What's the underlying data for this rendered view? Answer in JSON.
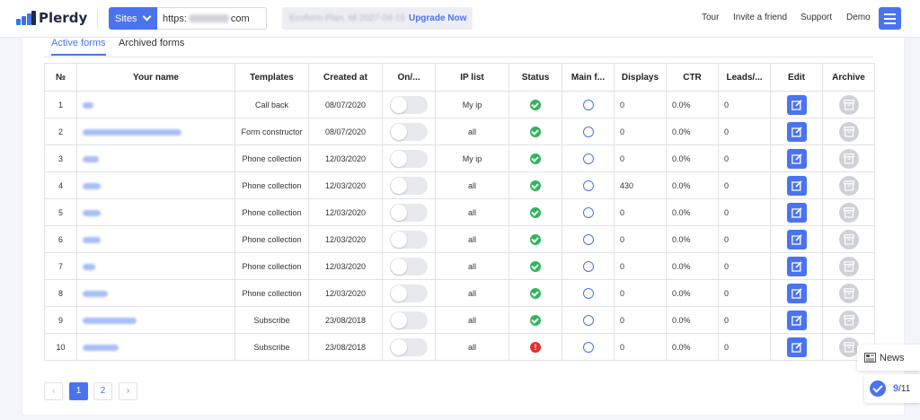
{
  "header": {
    "logo_text": "Plerdy",
    "sites_label": "Sites",
    "url_prefix": "https:",
    "url_suffix": "com",
    "plan_text": "Ecoform Plan, till 2027-04-15",
    "upgrade_label": "Upgrade Now",
    "links": [
      "Tour",
      "Invite a friend",
      "Support",
      "Demo"
    ]
  },
  "tabs": [
    "Active forms",
    "Archived forms"
  ],
  "table": {
    "columns": [
      "№",
      "Your name",
      "Templates",
      "Created at",
      "On/...",
      "IP list",
      "Status",
      "Main f...",
      "Displays",
      "CTR",
      "Leads/...",
      "Edit",
      "Archive"
    ],
    "rows": [
      {
        "num": "1",
        "template": "Call back",
        "created": "08/07/2020",
        "ip": "My ip",
        "status": "ok",
        "displays": "0",
        "ctr": "0.0%",
        "leads": "0"
      },
      {
        "num": "2",
        "template": "Form constructor",
        "created": "08/07/2020",
        "ip": "all",
        "status": "ok",
        "displays": "0",
        "ctr": "0.0%",
        "leads": "0"
      },
      {
        "num": "3",
        "template": "Phone collection",
        "created": "12/03/2020",
        "ip": "My ip",
        "status": "ok",
        "displays": "0",
        "ctr": "0.0%",
        "leads": "0"
      },
      {
        "num": "4",
        "template": "Phone collection",
        "created": "12/03/2020",
        "ip": "all",
        "status": "ok",
        "displays": "430",
        "ctr": "0.0%",
        "leads": "0"
      },
      {
        "num": "5",
        "template": "Phone collection",
        "created": "12/03/2020",
        "ip": "all",
        "status": "ok",
        "displays": "0",
        "ctr": "0.0%",
        "leads": "0"
      },
      {
        "num": "6",
        "template": "Phone collection",
        "created": "12/03/2020",
        "ip": "all",
        "status": "ok",
        "displays": "0",
        "ctr": "0.0%",
        "leads": "0"
      },
      {
        "num": "7",
        "template": "Phone collection",
        "created": "12/03/2020",
        "ip": "all",
        "status": "ok",
        "displays": "0",
        "ctr": "0.0%",
        "leads": "0"
      },
      {
        "num": "8",
        "template": "Phone collection",
        "created": "12/03/2020",
        "ip": "all",
        "status": "ok",
        "displays": "0",
        "ctr": "0.0%",
        "leads": "0"
      },
      {
        "num": "9",
        "template": "Subscribe",
        "created": "23/08/2018",
        "ip": "all",
        "status": "ok",
        "displays": "0",
        "ctr": "0.0%",
        "leads": "0"
      },
      {
        "num": "10",
        "template": "Subscribe",
        "created": "23/08/2018",
        "ip": "all",
        "status": "error",
        "displays": "0",
        "ctr": "0.0%",
        "leads": "0"
      }
    ]
  },
  "pagination": {
    "prev": "‹",
    "pages": [
      "1",
      "2"
    ],
    "current": "1",
    "next": "›"
  },
  "widgets": {
    "news_label": "News",
    "progress_done": "9",
    "progress_total": "/11"
  },
  "colors": {
    "accent": "#4a73f0",
    "success": "#2fb55c",
    "error": "#e23030"
  }
}
